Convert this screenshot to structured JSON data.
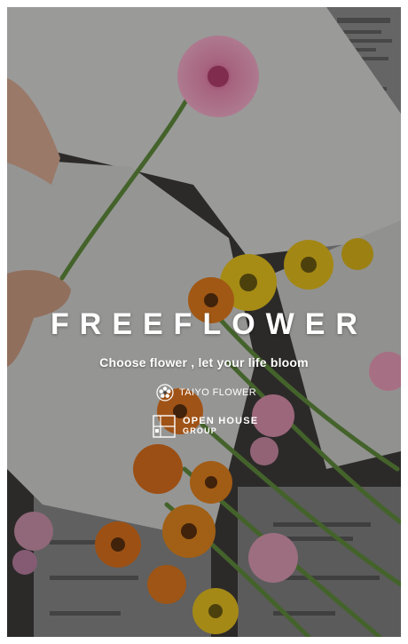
{
  "app": {
    "brand_name": "FREEFLOWER",
    "tagline": "Choose flower , let your life bloom"
  },
  "partners": {
    "taiyo": {
      "label": "TAIYO FLOWER",
      "icon": "flower-crest-icon"
    },
    "open_house": {
      "line1": "OPEN HOUSE",
      "line2": "GROUP",
      "icon": "house-logo-icon"
    }
  },
  "colors": {
    "text": "#ffffff",
    "gerbera_pink": "#e88ab0",
    "yellow": "#e6c21e",
    "orange": "#e07a1e",
    "stem_green": "#5f8a3c"
  }
}
